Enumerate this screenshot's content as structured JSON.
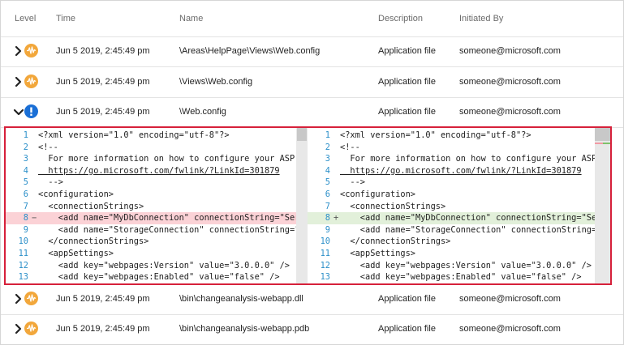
{
  "columns": {
    "level": "Level",
    "time": "Time",
    "name": "Name",
    "description": "Description",
    "initiated_by": "Initiated By"
  },
  "rows_top": [
    {
      "level": "warning",
      "time": "Jun 5 2019, 2:45:49 pm",
      "name": "\\Areas\\HelpPage\\Views\\Web.config",
      "description": "Application file",
      "user": "someone@microsoft.com",
      "expanded": false
    },
    {
      "level": "warning",
      "time": "Jun 5 2019, 2:45:49 pm",
      "name": "\\Views\\Web.config",
      "description": "Application file",
      "user": "someone@microsoft.com",
      "expanded": false
    },
    {
      "level": "error",
      "time": "Jun 5 2019, 2:45:49 pm",
      "name": "\\Web.config",
      "description": "Application file",
      "user": "someone@microsoft.com",
      "expanded": true
    }
  ],
  "rows_bottom": [
    {
      "level": "warning",
      "time": "Jun 5 2019, 2:45:49 pm",
      "name": "\\bin\\changeanalysis-webapp.dll",
      "description": "Application file",
      "user": "someone@microsoft.com",
      "expanded": false
    },
    {
      "level": "warning",
      "time": "Jun 5 2019, 2:45:49 pm",
      "name": "\\bin\\changeanalysis-webapp.pdb",
      "description": "Application file",
      "user": "someone@microsoft.com",
      "expanded": false
    }
  ],
  "diff": {
    "left": [
      {
        "n": "1",
        "mark": "",
        "code": "<?xml version=\"1.0\" encoding=\"utf-8\"?>",
        "type": ""
      },
      {
        "n": "2",
        "mark": "",
        "code": "<!--",
        "type": ""
      },
      {
        "n": "3",
        "mark": "",
        "code": "  For more information on how to configure your ASP.N",
        "type": ""
      },
      {
        "n": "4",
        "mark": "",
        "code": "  https://go.microsoft.com/fwlink/?LinkId=301879",
        "type": "link"
      },
      {
        "n": "5",
        "mark": "",
        "code": "  -->",
        "type": ""
      },
      {
        "n": "6",
        "mark": "",
        "code": "<configuration>",
        "type": ""
      },
      {
        "n": "7",
        "mark": "",
        "code": "  <connectionStrings>",
        "type": ""
      },
      {
        "n": "8",
        "mark": "−",
        "code": "    <add name=\"MyDbConnection\" connectionString=\"Serv",
        "type": "del"
      },
      {
        "n": "9",
        "mark": "",
        "code": "    <add name=\"StorageConnection\" connectionString=\"D",
        "type": ""
      },
      {
        "n": "10",
        "mark": "",
        "code": "  </connectionStrings>",
        "type": ""
      },
      {
        "n": "11",
        "mark": "",
        "code": "  <appSettings>",
        "type": ""
      },
      {
        "n": "12",
        "mark": "",
        "code": "    <add key=\"webpages:Version\" value=\"3.0.0.0\" />",
        "type": ""
      },
      {
        "n": "13",
        "mark": "",
        "code": "    <add key=\"webpages:Enabled\" value=\"false\" />",
        "type": ""
      }
    ],
    "right": [
      {
        "n": "1",
        "mark": "",
        "code": "<?xml version=\"1.0\" encoding=\"utf-8\"?>",
        "type": ""
      },
      {
        "n": "2",
        "mark": "",
        "code": "<!--",
        "type": ""
      },
      {
        "n": "3",
        "mark": "",
        "code": "  For more information on how to configure your ASP.N",
        "type": ""
      },
      {
        "n": "4",
        "mark": "",
        "code": "  https://go.microsoft.com/fwlink/?LinkId=301879",
        "type": "link"
      },
      {
        "n": "5",
        "mark": "",
        "code": "  -->",
        "type": ""
      },
      {
        "n": "6",
        "mark": "",
        "code": "<configuration>",
        "type": ""
      },
      {
        "n": "7",
        "mark": "",
        "code": "  <connectionStrings>",
        "type": ""
      },
      {
        "n": "8",
        "mark": "+",
        "code": "    <add name=\"MyDbConnection\" connectionString=\"Serv",
        "type": "add"
      },
      {
        "n": "9",
        "mark": "",
        "code": "    <add name=\"StorageConnection\" connectionString=\"D",
        "type": ""
      },
      {
        "n": "10",
        "mark": "",
        "code": "  </connectionStrings>",
        "type": ""
      },
      {
        "n": "11",
        "mark": "",
        "code": "  <appSettings>",
        "type": ""
      },
      {
        "n": "12",
        "mark": "",
        "code": "    <add key=\"webpages:Version\" value=\"3.0.0.0\" />",
        "type": ""
      },
      {
        "n": "13",
        "mark": "",
        "code": "    <add key=\"webpages:Enabled\" value=\"false\" />",
        "type": ""
      }
    ]
  },
  "colors": {
    "warning": "#f2a73b",
    "error": "#1a6fd6",
    "deleted_line": "#fbd2d6",
    "added_line": "#e2f0da",
    "highlight_border": "#d6203a"
  },
  "icons": {
    "collapsed": "chevron-right-icon",
    "expanded": "chevron-down-icon",
    "warning": "warning-pulse-icon",
    "error": "error-exclamation-icon"
  }
}
